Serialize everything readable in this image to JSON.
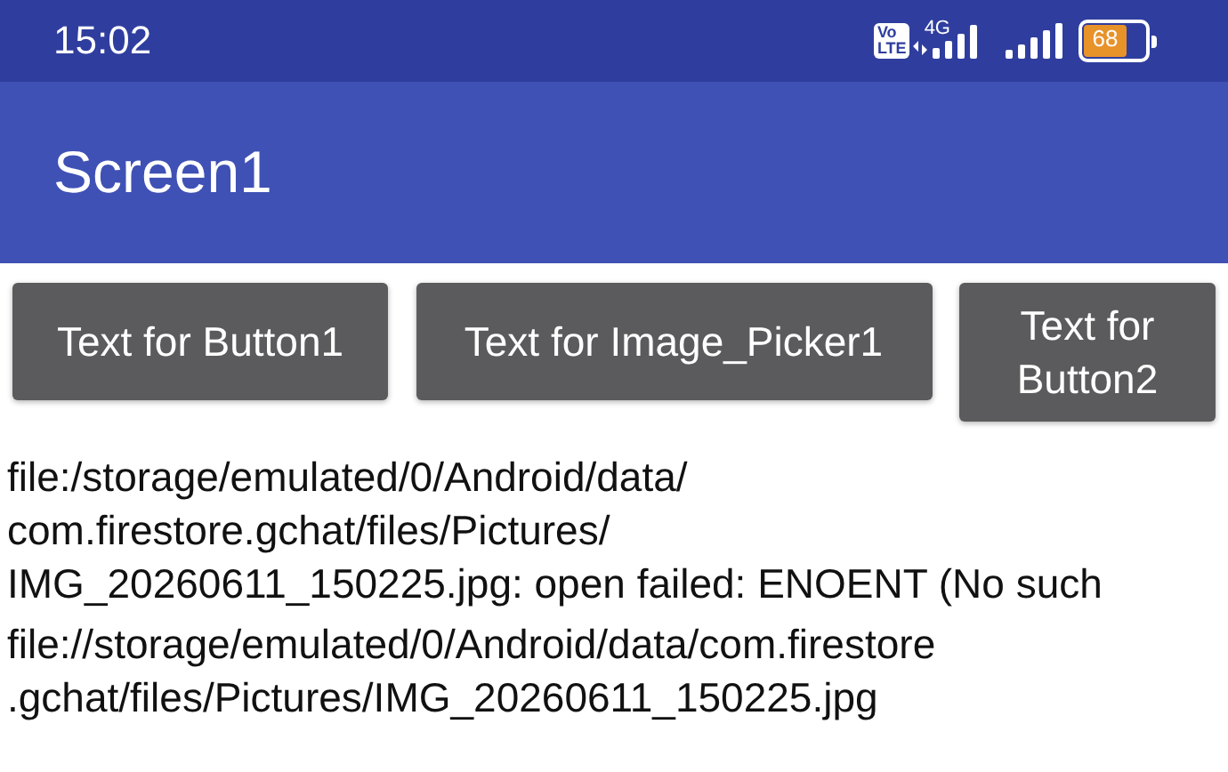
{
  "status_bar": {
    "time": "15:02",
    "network": "4G",
    "volte": [
      "Vo",
      "LTE"
    ],
    "battery": "68"
  },
  "app_bar": {
    "title": "Screen1"
  },
  "buttons": [
    {
      "lines": [
        "Text for Button1"
      ]
    },
    {
      "lines": [
        "Text for Image_Picker1"
      ]
    },
    {
      "lines": [
        "Text for",
        "Button2"
      ]
    }
  ],
  "labels": [
    {
      "lines": [
        "file:/storage/emulated/0/Android/data/",
        "com.firestore.gchat/files/Pictures/",
        "IMG_20260611_150225.jpg: open failed: ENOENT (No such"
      ]
    },
    {
      "lines": [
        "file://storage/emulated/0/Android/data/com.firestore",
        ".gchat/files/Pictures/IMG_20260611_150225.jpg"
      ]
    }
  ]
}
